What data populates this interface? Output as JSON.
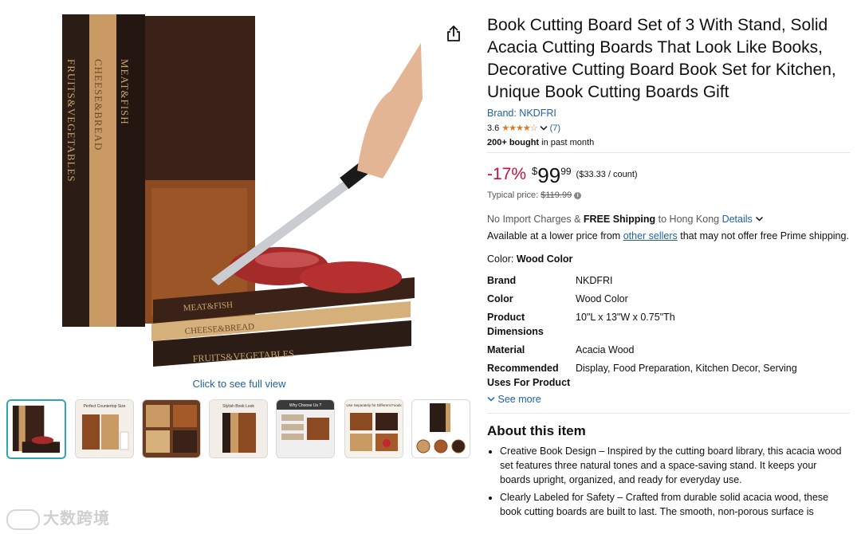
{
  "product": {
    "title": "Book Cutting Board Set of 3 With Stand, Solid Acacia Cutting Boards That Look Like Books, Decorative Cutting Board Book Set for Kitchen, Unique Book Cutting Boards Gift",
    "brand_link": "Brand: NKDFRI",
    "rating_value": "3.6",
    "rating_stars": "★★★★☆",
    "rating_count": "(7)",
    "bought_bold": "200+ bought",
    "bought_rest": " in past month"
  },
  "price": {
    "discount": "-17%",
    "currency": "$",
    "whole": "99",
    "fraction": "99",
    "unit": "($33.33 / count)",
    "typical_label": "Typical price: ",
    "typical_value": "$119.99"
  },
  "shipping": {
    "pre": "No Import Charges & ",
    "bold": "FREE Shipping",
    "dest": " to Hong Kong ",
    "details": "Details"
  },
  "availability": {
    "pre": "Available at a lower price from ",
    "link": "other sellers",
    "post": " that may not offer free Prime shipping."
  },
  "color": {
    "label": "Color: ",
    "value": "Wood Color"
  },
  "specs": [
    {
      "key": "Brand",
      "value": "NKDFRI"
    },
    {
      "key": "Color",
      "value": "Wood Color"
    },
    {
      "key": "Product Dimensions",
      "value": "10\"L x 13\"W x 0.75\"Th"
    },
    {
      "key": "Material",
      "value": "Acacia Wood"
    },
    {
      "key": "Recommended Uses For Product",
      "value": "Display, Food Preparation, Kitchen Decor, Serving"
    }
  ],
  "see_more": "See more",
  "about": {
    "heading": "About this item",
    "bullets": [
      "Creative Book Design – Inspired by the cutting board library, this acacia wood set features three natural tones and a space-saving stand. It keeps your boards upright, organized, and ready for everyday use.",
      "Clearly Labeled for Safety – Crafted from durable solid acacia wood, these book cutting boards are built to last. The smooth, non-porous surface is"
    ]
  },
  "gallery": {
    "click_full": "Click to see full view",
    "spine_labels": [
      "FRUITS&VEGETABLES",
      "CHEESE&BREAD",
      "MEAT&FISH"
    ],
    "stack_labels": [
      "MEAT&FISH",
      "CHEESE&BREAD",
      "FRUITS&VEGETABLES"
    ],
    "thumb_titles": [
      "",
      "Perfect Countertop Size",
      "",
      "Stylish Book Look",
      "Why Choose Us ?",
      "Use Separately for Different Foods",
      ""
    ]
  },
  "watermark": "大数跨境",
  "colors": {
    "link": "#2162a1",
    "discount": "#cc0c39",
    "star": "#de7921",
    "selected_thumb": "#2ea3b1"
  }
}
